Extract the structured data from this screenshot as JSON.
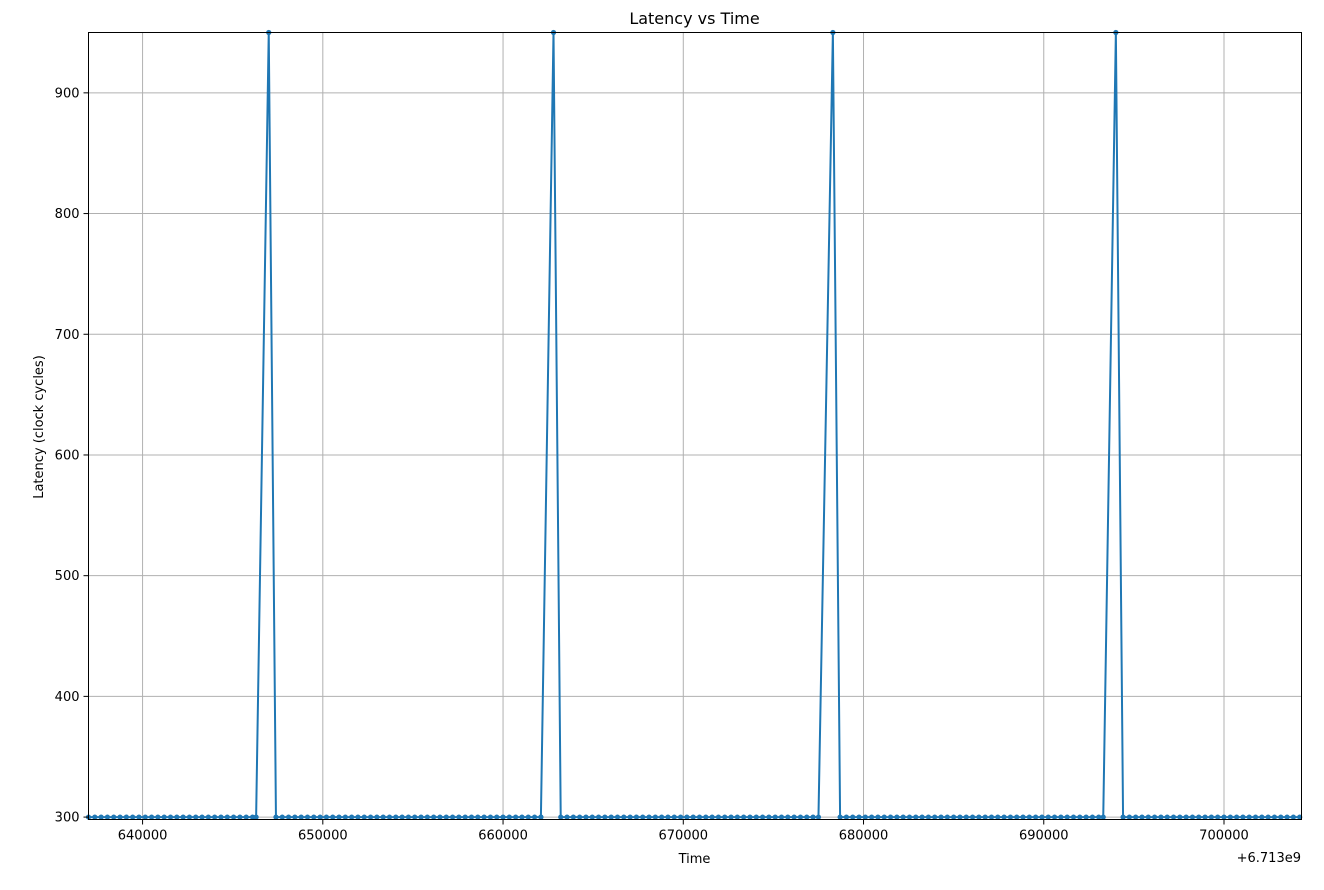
{
  "chart_data": {
    "type": "line",
    "title": "Latency vs Time",
    "xlabel": "Time",
    "ylabel": "Latency (clock cycles)",
    "x_offset_label": "+6.713e9",
    "x_offset": 6713000000,
    "xlim": [
      637000,
      704300
    ],
    "ylim": [
      298,
      950
    ],
    "x_ticks": [
      640000,
      650000,
      660000,
      670000,
      680000,
      690000,
      700000
    ],
    "x_tick_labels": [
      "640000",
      "650000",
      "660000",
      "670000",
      "680000",
      "690000",
      "700000"
    ],
    "y_ticks": [
      300,
      400,
      500,
      600,
      700,
      800,
      900
    ],
    "y_tick_labels": [
      "300",
      "400",
      "500",
      "600",
      "700",
      "800",
      "900"
    ],
    "grid": true,
    "series": [
      {
        "color": "#1f77b4",
        "marker": "circle",
        "baseline": 300,
        "sample_spacing": 350,
        "start": 637000,
        "end": 704300,
        "spikes": [
          {
            "before": 646300,
            "peak": 647000,
            "after": 647400
          },
          {
            "before": 662100,
            "peak": 662800,
            "after": 663200
          },
          {
            "before": 677500,
            "peak": 678300,
            "after": 678700
          },
          {
            "before": 693300,
            "peak": 694000,
            "after": 694400
          }
        ],
        "peak_value": 950
      }
    ]
  }
}
